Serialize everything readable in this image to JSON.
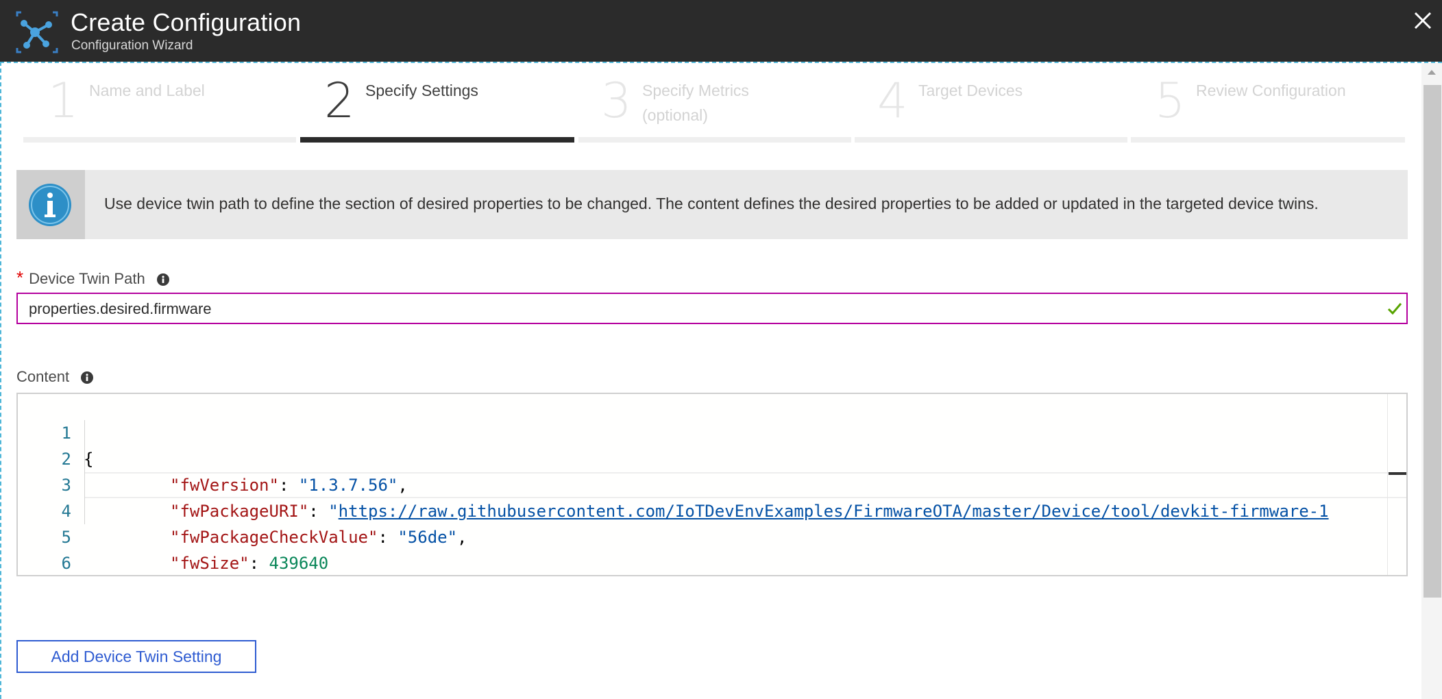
{
  "header": {
    "title": "Create Configuration",
    "subtitle": "Configuration Wizard",
    "logo_icon": "iot-hub-icon",
    "close_icon": "close-icon"
  },
  "steps": [
    {
      "number": "1",
      "label": "Name and Label",
      "active": false
    },
    {
      "number": "2",
      "label": "Specify Settings",
      "active": true
    },
    {
      "number": "3",
      "label": "Specify Metrics (optional)",
      "active": false
    },
    {
      "number": "4",
      "label": "Target Devices",
      "active": false
    },
    {
      "number": "5",
      "label": "Review Configuration",
      "active": false
    }
  ],
  "info": {
    "text": "Use device twin path to define the section of desired properties to be changed. The content defines the desired properties to be added or updated in the targeted device twins."
  },
  "device_twin_path": {
    "required_mark": "*",
    "label": "Device Twin Path",
    "value": "properties.desired.firmware"
  },
  "content": {
    "label": "Content",
    "lines": [
      {
        "num": "1",
        "text": "{"
      },
      {
        "num": "2",
        "key": "\"fwVersion\"",
        "value": "\"1.3.7.56\"",
        "trail": ","
      },
      {
        "num": "3",
        "key": "\"fwPackageURI\"",
        "value_prefix": "\"",
        "value": "https://raw.githubusercontent.com/IoTDevEnvExamples/FirmwareOTA/master/Device/tool/devkit-firmware-1"
      },
      {
        "num": "4",
        "key": "\"fwPackageCheckValue\"",
        "value": "\"56de\"",
        "trail": ","
      },
      {
        "num": "5",
        "key": "\"fwSize\"",
        "value": "439640"
      },
      {
        "num": "6",
        "text": "}"
      }
    ]
  },
  "buttons": {
    "add_setting": "Add Device Twin Setting"
  },
  "colors": {
    "header_bg": "#2b2b2b",
    "active_step_bar": "#2b2b2b",
    "input_border": "#b4009e",
    "valid_check": "#57a300",
    "info_icon": "#2d8fc7",
    "button_accent": "#2e5bd1",
    "json_key": "#a31515",
    "json_string": "#0451a5",
    "json_number": "#098658"
  }
}
